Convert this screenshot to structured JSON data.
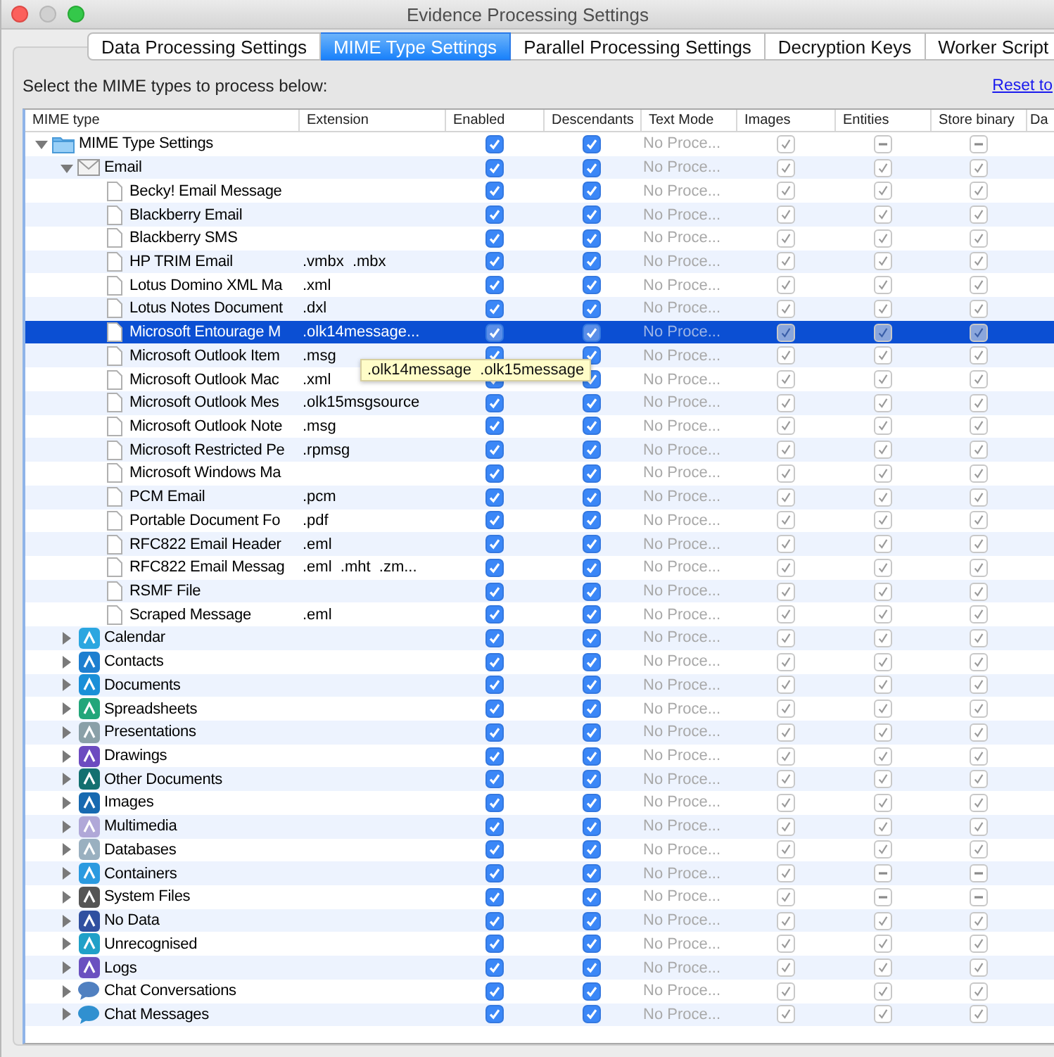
{
  "window": {
    "title": "Evidence Processing Settings"
  },
  "tabs": [
    {
      "label": "Data Processing Settings",
      "selected": false
    },
    {
      "label": "MIME Type Settings",
      "selected": true
    },
    {
      "label": "Parallel Processing Settings",
      "selected": false
    },
    {
      "label": "Decryption Keys",
      "selected": false
    },
    {
      "label": "Worker Script",
      "selected": false
    }
  ],
  "instruction": "Select the MIME types to process below:",
  "reset_link": "Reset to",
  "table": {
    "columns": [
      "MIME type",
      "Extension",
      "Enabled",
      "Descendants",
      "Text Mode",
      "Images",
      "Entities",
      "Store binary",
      "Da"
    ],
    "tree": [
      {
        "kind": "folder",
        "label": "MIME Type Settings",
        "expanded": true,
        "selected": false,
        "enabled": true,
        "descendants": true,
        "text_mode": "No Proce...",
        "images": true,
        "entities": true,
        "entities_mixed": true,
        "store_binary": true,
        "store_binary_mixed": true,
        "children": [
          {
            "kind": "email",
            "label": "Email",
            "expanded": true,
            "selected": false,
            "enabled": true,
            "descendants": true,
            "text_mode": "No Proce...",
            "images": true,
            "entities": true,
            "entities_mixed": false,
            "store_binary": true,
            "store_binary_mixed": false,
            "children": [
              {
                "kind": "file",
                "label": "Becky! Email Message",
                "selected": false,
                "enabled": true,
                "descendants": true,
                "text_mode": "No Proce...",
                "images": true,
                "entities": true,
                "entities_mixed": false,
                "store_binary": true,
                "store_binary_mixed": false
              },
              {
                "kind": "file",
                "label": "Blackberry Email",
                "selected": false,
                "enabled": true,
                "descendants": true,
                "text_mode": "No Proce...",
                "images": true,
                "entities": true,
                "entities_mixed": false,
                "store_binary": true,
                "store_binary_mixed": false
              },
              {
                "kind": "file",
                "label": "Blackberry SMS",
                "selected": false,
                "enabled": true,
                "descendants": true,
                "text_mode": "No Proce...",
                "images": true,
                "entities": true,
                "entities_mixed": false,
                "store_binary": true,
                "store_binary_mixed": false
              },
              {
                "kind": "file",
                "label": "HP TRIM Email",
                "extension": ".vmbx  .mbx",
                "selected": false,
                "enabled": true,
                "descendants": true,
                "text_mode": "No Proce...",
                "images": true,
                "entities": true,
                "entities_mixed": false,
                "store_binary": true,
                "store_binary_mixed": false
              },
              {
                "kind": "file",
                "label": "Lotus Domino XML Ma",
                "extension": ".xml",
                "selected": false,
                "enabled": true,
                "descendants": true,
                "text_mode": "No Proce...",
                "images": true,
                "entities": true,
                "entities_mixed": false,
                "store_binary": true,
                "store_binary_mixed": false
              },
              {
                "kind": "file",
                "label": "Lotus Notes Document",
                "extension": ".dxl",
                "selected": false,
                "enabled": true,
                "descendants": true,
                "text_mode": "No Proce...",
                "images": true,
                "entities": true,
                "entities_mixed": false,
                "store_binary": true,
                "store_binary_mixed": false
              },
              {
                "kind": "file",
                "label": "Microsoft Entourage M",
                "extension": ".olk14message...",
                "selected": true,
                "enabled": true,
                "descendants": true,
                "text_mode": "No Proce...",
                "images": true,
                "entities": true,
                "entities_mixed": false,
                "store_binary": true,
                "store_binary_mixed": false
              },
              {
                "kind": "file",
                "label": "Microsoft Outlook Item",
                "extension": ".msg",
                "selected": false,
                "enabled": true,
                "descendants": true,
                "text_mode": "No Proce...",
                "images": true,
                "entities": true,
                "entities_mixed": false,
                "store_binary": true,
                "store_binary_mixed": false
              },
              {
                "kind": "file",
                "label": "Microsoft Outlook Mac",
                "extension": ".xml",
                "selected": false,
                "enabled": true,
                "descendants": true,
                "text_mode": "No Proce...",
                "images": true,
                "entities": true,
                "entities_mixed": false,
                "store_binary": true,
                "store_binary_mixed": false
              },
              {
                "kind": "file",
                "label": "Microsoft Outlook Mes",
                "extension": ".olk15msgsource",
                "selected": false,
                "enabled": true,
                "descendants": true,
                "text_mode": "No Proce...",
                "images": true,
                "entities": true,
                "entities_mixed": false,
                "store_binary": true,
                "store_binary_mixed": false
              },
              {
                "kind": "file",
                "label": "Microsoft Outlook Note",
                "extension": ".msg",
                "selected": false,
                "enabled": true,
                "descendants": true,
                "text_mode": "No Proce...",
                "images": true,
                "entities": true,
                "entities_mixed": false,
                "store_binary": true,
                "store_binary_mixed": false
              },
              {
                "kind": "file",
                "label": "Microsoft Restricted Pe",
                "extension": ".rpmsg",
                "selected": false,
                "enabled": true,
                "descendants": true,
                "text_mode": "No Proce...",
                "images": true,
                "entities": true,
                "entities_mixed": false,
                "store_binary": true,
                "store_binary_mixed": false
              },
              {
                "kind": "file",
                "label": "Microsoft Windows Ma",
                "selected": false,
                "enabled": true,
                "descendants": true,
                "text_mode": "No Proce...",
                "images": true,
                "entities": true,
                "entities_mixed": false,
                "store_binary": true,
                "store_binary_mixed": false
              },
              {
                "kind": "file",
                "label": "PCM Email",
                "extension": ".pcm",
                "selected": false,
                "enabled": true,
                "descendants": true,
                "text_mode": "No Proce...",
                "images": true,
                "entities": true,
                "entities_mixed": false,
                "store_binary": true,
                "store_binary_mixed": false
              },
              {
                "kind": "file",
                "label": "Portable Document Fo",
                "extension": ".pdf",
                "selected": false,
                "enabled": true,
                "descendants": true,
                "text_mode": "No Proce...",
                "images": true,
                "entities": true,
                "entities_mixed": false,
                "store_binary": true,
                "store_binary_mixed": false
              },
              {
                "kind": "file",
                "label": "RFC822 Email Header",
                "extension": ".eml",
                "selected": false,
                "enabled": true,
                "descendants": true,
                "text_mode": "No Proce...",
                "images": true,
                "entities": true,
                "entities_mixed": false,
                "store_binary": true,
                "store_binary_mixed": false
              },
              {
                "kind": "file",
                "label": "RFC822 Email Messag",
                "extension": ".eml  .mht  .zm...",
                "selected": false,
                "enabled": true,
                "descendants": true,
                "text_mode": "No Proce...",
                "images": true,
                "entities": true,
                "entities_mixed": false,
                "store_binary": true,
                "store_binary_mixed": false
              },
              {
                "kind": "file",
                "label": "RSMF File",
                "selected": false,
                "enabled": true,
                "descendants": true,
                "text_mode": "No Proce...",
                "images": true,
                "entities": true,
                "entities_mixed": false,
                "store_binary": true,
                "store_binary_mixed": false
              },
              {
                "kind": "file",
                "label": "Scraped Message",
                "extension": ".eml",
                "selected": false,
                "enabled": true,
                "descendants": true,
                "text_mode": "No Proce...",
                "images": true,
                "entities": true,
                "entities_mixed": false,
                "store_binary": true,
                "store_binary_mixed": false
              }
            ]
          },
          {
            "kind": "category",
            "color": "#2ba6e0",
            "label": "Calendar",
            "expanded": false,
            "selected": false,
            "enabled": true,
            "descendants": true,
            "text_mode": "No Proce...",
            "images": true,
            "entities": true,
            "entities_mixed": false,
            "store_binary": true,
            "store_binary_mixed": false
          },
          {
            "kind": "category",
            "color": "#1e7fd0",
            "label": "Contacts",
            "expanded": false,
            "selected": false,
            "enabled": true,
            "descendants": true,
            "text_mode": "No Proce...",
            "images": true,
            "entities": true,
            "entities_mixed": false,
            "store_binary": true,
            "store_binary_mixed": false
          },
          {
            "kind": "category",
            "color": "#1a8fd8",
            "label": "Documents",
            "expanded": false,
            "selected": false,
            "enabled": true,
            "descendants": true,
            "text_mode": "No Proce...",
            "images": true,
            "entities": true,
            "entities_mixed": false,
            "store_binary": true,
            "store_binary_mixed": false
          },
          {
            "kind": "category",
            "color": "#22a67a",
            "label": "Spreadsheets",
            "expanded": false,
            "selected": false,
            "enabled": true,
            "descendants": true,
            "text_mode": "No Proce...",
            "images": true,
            "entities": true,
            "entities_mixed": false,
            "store_binary": true,
            "store_binary_mixed": false
          },
          {
            "kind": "category",
            "color": "#8aa0a8",
            "label": "Presentations",
            "expanded": false,
            "selected": false,
            "enabled": true,
            "descendants": true,
            "text_mode": "No Proce...",
            "images": true,
            "entities": true,
            "entities_mixed": false,
            "store_binary": true,
            "store_binary_mixed": false
          },
          {
            "kind": "category",
            "color": "#6c4bc0",
            "label": "Drawings",
            "expanded": false,
            "selected": false,
            "enabled": true,
            "descendants": true,
            "text_mode": "No Proce...",
            "images": true,
            "entities": true,
            "entities_mixed": false,
            "store_binary": true,
            "store_binary_mixed": false
          },
          {
            "kind": "category",
            "color": "#137070",
            "label": "Other Documents",
            "expanded": false,
            "selected": false,
            "enabled": true,
            "descendants": true,
            "text_mode": "No Proce...",
            "images": true,
            "entities": true,
            "entities_mixed": false,
            "store_binary": true,
            "store_binary_mixed": false
          },
          {
            "kind": "category",
            "color": "#1769b0",
            "label": "Images",
            "expanded": false,
            "selected": false,
            "enabled": true,
            "descendants": true,
            "text_mode": "No Proce...",
            "images": true,
            "entities": true,
            "entities_mixed": false,
            "store_binary": true,
            "store_binary_mixed": false
          },
          {
            "kind": "category",
            "color": "#b0a8d8",
            "label": "Multimedia",
            "expanded": false,
            "selected": false,
            "enabled": true,
            "descendants": true,
            "text_mode": "No Proce...",
            "images": true,
            "entities": true,
            "entities_mixed": false,
            "store_binary": true,
            "store_binary_mixed": false
          },
          {
            "kind": "category",
            "color": "#9ab0c0",
            "label": "Databases",
            "expanded": false,
            "selected": false,
            "enabled": true,
            "descendants": true,
            "text_mode": "No Proce...",
            "images": true,
            "entities": true,
            "entities_mixed": false,
            "store_binary": true,
            "store_binary_mixed": false
          },
          {
            "kind": "category",
            "color": "#2a9ae0",
            "label": "Containers",
            "expanded": false,
            "selected": false,
            "enabled": true,
            "descendants": true,
            "text_mode": "No Proce...",
            "images": true,
            "entities": true,
            "entities_mixed": true,
            "store_binary": true,
            "store_binary_mixed": true
          },
          {
            "kind": "category",
            "color": "#555555",
            "label": "System Files",
            "expanded": false,
            "selected": false,
            "enabled": true,
            "descendants": true,
            "text_mode": "No Proce...",
            "images": true,
            "entities": true,
            "entities_mixed": true,
            "store_binary": true,
            "store_binary_mixed": true
          },
          {
            "kind": "category",
            "color": "#3050a0",
            "label": "No Data",
            "expanded": false,
            "selected": false,
            "enabled": true,
            "descendants": true,
            "text_mode": "No Proce...",
            "images": true,
            "entities": true,
            "entities_mixed": false,
            "store_binary": true,
            "store_binary_mixed": false
          },
          {
            "kind": "category",
            "color": "#20a0c8",
            "label": "Unrecognised",
            "expanded": false,
            "selected": false,
            "enabled": true,
            "descendants": true,
            "text_mode": "No Proce...",
            "images": true,
            "entities": true,
            "entities_mixed": false,
            "store_binary": true,
            "store_binary_mixed": false
          },
          {
            "kind": "category",
            "color": "#6a50c0",
            "label": "Logs",
            "expanded": false,
            "selected": false,
            "enabled": true,
            "descendants": true,
            "text_mode": "No Proce...",
            "images": true,
            "entities": true,
            "entities_mixed": false,
            "store_binary": true,
            "store_binary_mixed": false
          },
          {
            "kind": "chat",
            "color": "#5080c0",
            "label": "Chat Conversations",
            "expanded": false,
            "selected": false,
            "enabled": true,
            "descendants": true,
            "text_mode": "No Proce...",
            "images": true,
            "entities": true,
            "entities_mixed": false,
            "store_binary": true,
            "store_binary_mixed": false
          },
          {
            "kind": "chat",
            "color": "#3090d0",
            "label": "Chat Messages",
            "expanded": false,
            "selected": false,
            "enabled": true,
            "descendants": true,
            "text_mode": "No Proce...",
            "images": true,
            "entities": true,
            "entities_mixed": false,
            "store_binary": true,
            "store_binary_mixed": false
          }
        ]
      }
    ]
  },
  "tooltip": {
    "text": ".olk14message  .olk15message"
  }
}
